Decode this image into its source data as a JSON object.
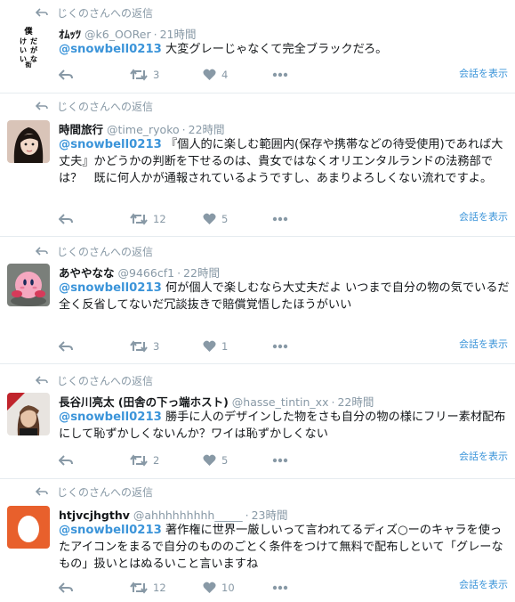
{
  "tweets": [
    {
      "context": "じくのさんへの返信",
      "name": "ｵﾑｯﾂ",
      "handle": "@k6_OORer",
      "time": "21時間",
      "mention": "@snowbell0213",
      "text": " 大変グレーじゃなくて完全ブラックだろ。",
      "retweets": "3",
      "likes": "4",
      "show_conversation": "会話を表示",
      "avatar_text": "僕だけがいない街"
    },
    {
      "context": "じくのさんへの返信",
      "name": "時間旅行",
      "handle": "@time_ryoko",
      "time": "22時間",
      "mention": "@snowbell0213",
      "text": " 『個人的に楽しむ範囲内(保存や携帯などの待受使用)であれば大丈夫』かどうかの判断を下せるのは、貴女ではなくオリエンタルランドの法務部では？　既に何人かが通報されているようですし、あまりよろしくない流れですよ。",
      "retweets": "12",
      "likes": "5",
      "show_conversation": "会話を表示"
    },
    {
      "context": "じくのさんへの返信",
      "name": "あややなな",
      "handle": "@9466cf1",
      "time": "22時間",
      "mention": "@snowbell0213",
      "text": " 何が個人で楽しむなら大丈夫だよ いつまで自分の物の気でいるだ全く反省してないだ冗談抜きで賠償覚悟したほうがいい",
      "retweets": "3",
      "likes": "1",
      "show_conversation": "会話を表示"
    },
    {
      "context": "じくのさんへの返信",
      "name": "長谷川亮太 (田舎の下っ端ホスト)",
      "handle": "@hasse_tintin_xx",
      "time": "22時間",
      "mention": "@snowbell0213",
      "text": " 勝手に人のデザインした物をさも自分の物の様にフリー素材配布にして恥ずかしくないんか？ワイは恥ずかしくない",
      "retweets": "2",
      "likes": "5",
      "show_conversation": "会話を表示"
    },
    {
      "context": "じくのさんへの返信",
      "name": "htjvcjhgthv",
      "handle": "@ahhhhhhhhh_____",
      "time": "23時間",
      "mention": "@snowbell0213",
      "text": " 著作権に世界一厳しいって言われてるディズ○ーのキャラを使ったアイコンをまるで自分のもののごとく条件をつけて無料で配布しといて「グレーなもの」扱いとはぬるいこと言いますね",
      "retweets": "12",
      "likes": "10",
      "show_conversation": "会話を表示"
    }
  ],
  "colors": {
    "accent": "#3b94d9",
    "muted": "#8899a6",
    "separator": "#e6ecf0"
  }
}
